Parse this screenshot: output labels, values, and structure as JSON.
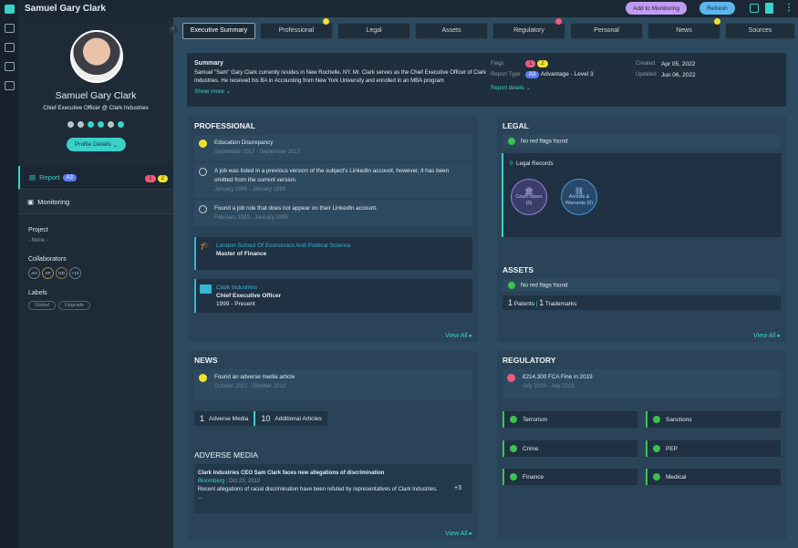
{
  "header": {
    "title": "Samuel Gary Clark",
    "add_monitoring": "Add to Monitoring",
    "refresh": "Refresh"
  },
  "colors": {
    "accent": "#3ad1c8",
    "flag_red": "#f05a7e",
    "flag_yellow": "#f2e22b",
    "ok_green": "#3cc24f",
    "monitor_btn": "#c39af2",
    "refresh_btn": "#5eb6f0"
  },
  "profile": {
    "name": "Samuel Gary Clark",
    "role": "Chief Executive Officer @ Clark Industries",
    "socials": [
      "globe-icon",
      "instagram-icon",
      "twitter-icon",
      "linkedin-icon",
      "facebook-icon",
      "youtube-icon"
    ],
    "details_btn": "Profile Details"
  },
  "sidebar": {
    "report": "Report",
    "report_badge": "A3",
    "red_flags": "1",
    "yellow_flags": "2",
    "monitoring": "Monitoring",
    "project_label": "Project",
    "project_value": "- None -",
    "collaborators_label": "Collaborators",
    "collaborators": [
      "AH",
      "AP",
      "GD",
      "+13"
    ],
    "labels_label": "Labels",
    "labels": [
      "Global",
      "Upgrade"
    ]
  },
  "tabs": [
    {
      "label": "Executive Summary"
    },
    {
      "label": "Professional"
    },
    {
      "label": "Legal"
    },
    {
      "label": "Assets"
    },
    {
      "label": "Regulatory"
    },
    {
      "label": "Personal"
    },
    {
      "label": "News"
    },
    {
      "label": "Sources"
    }
  ],
  "summary": {
    "title": "Summary",
    "text": "Samuel \"Sam\" Gary Clark currently resides in New Rochelle, NY. Mr. Clark serves as the Chief Executive Officer of Clark Industries. He received his BA in Accounting from New York University and enrolled in an MBA program",
    "show_more": "Show more",
    "flags_label": "Flags",
    "red_flags": "1",
    "yellow_flags": "2",
    "report_type_label": "Report Type",
    "report_type_badge": "A3",
    "report_type": "Advantage - Level 3",
    "report_details": "Report details",
    "created_label": "Created",
    "created": "Apr 05, 2022",
    "updated_label": "Updated",
    "updated": "Jun 06, 2022"
  },
  "professional": {
    "title": "PROFESSIONAL",
    "items": [
      {
        "text": "Education Discrepancy",
        "date": "September 2017 - September 2017"
      },
      {
        "text": "A job was listed in a previous version of the subject's LinkedIn account, however, it has been omitted from the current version.",
        "date": "January 1996 - January 1999"
      },
      {
        "text": "Found a job role that does not appear on their LinkedIn account.",
        "date": "February 1992 - January 1995"
      }
    ],
    "education": {
      "school": "London School Of Economics And Political Science",
      "degree": "Master of Finance"
    },
    "job": {
      "company": "Clark Industries",
      "title": "Chief Executive Officer",
      "period": "1999 - Present"
    },
    "view_all": "View All"
  },
  "legal": {
    "title": "LEGAL",
    "status": "No red flags found",
    "records_count": "0",
    "records_label": "Legal Records",
    "court": "Court cases",
    "court_count": "(0)",
    "arrests": "Arrests & Warrants (0)"
  },
  "assets": {
    "title": "ASSETS",
    "status": "No red flags found",
    "patents_count": "1",
    "patents": "Patents",
    "trademarks_count": "1",
    "trademarks": "Trademarks",
    "view_all": "View All"
  },
  "news": {
    "title": "NEWS",
    "item": "Found an adverse media article",
    "date": "October 2012 - October 2012",
    "adverse_count": "1",
    "adverse": "Adverse Media",
    "additional_count": "10",
    "additional": "Additional Articles",
    "adverse_title": "ADVERSE MEDIA",
    "article_title": "Clark Industries CEO Sam Clark faces new allegations of discrimination",
    "source": "Bloomberg",
    "article_date": "Oct 23, 2012",
    "snippet": "Recent allegations of racial discrimination have been refuted by representatives of Clark Industries.",
    "ellipsis": "...",
    "more": "+3",
    "view_all": "View All"
  },
  "regulatory": {
    "title": "REGULATORY",
    "item": "£214,300 FCA Fine in 2019",
    "date": "July 2019 - July 2019",
    "checks": [
      "Terrorism",
      "Sanctions",
      "Crime",
      "PEP",
      "Finance",
      "Medical"
    ]
  }
}
